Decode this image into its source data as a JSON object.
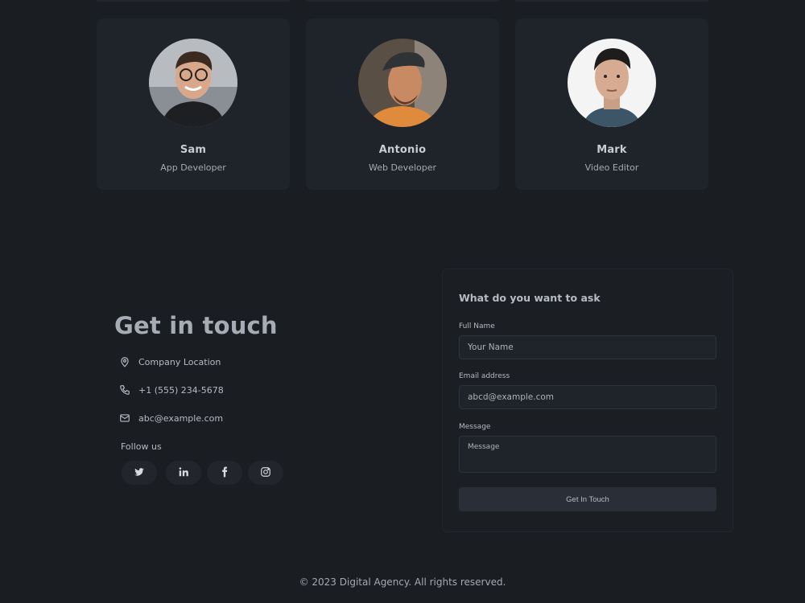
{
  "team": [
    {
      "name": "Sam",
      "role": "App Developer"
    },
    {
      "name": "Antonio",
      "role": "Web Developer"
    },
    {
      "name": "Mark",
      "role": "Video Editor"
    }
  ],
  "contact": {
    "title": "Get in touch",
    "location": "Company Location",
    "phone": "+1 (555) 234-5678",
    "email": "abc@example.com",
    "follow_label": "Follow us",
    "socials": [
      "twitter-icon",
      "linkedin-icon",
      "facebook-icon",
      "instagram-icon"
    ]
  },
  "form": {
    "heading": "What do you want to ask",
    "name_label": "Full Name",
    "name_placeholder": "Your Name",
    "email_label": "Email address",
    "email_placeholder": "abcd@example.com",
    "message_label": "Message",
    "message_placeholder": "Message",
    "submit_label": "Get In Touch"
  },
  "footer": {
    "copyright": "© 2023 Digital Agency. All rights reserved."
  },
  "colors": {
    "background": "#1a1d21",
    "card": "#1f232a",
    "text": "#c9ccd1"
  }
}
